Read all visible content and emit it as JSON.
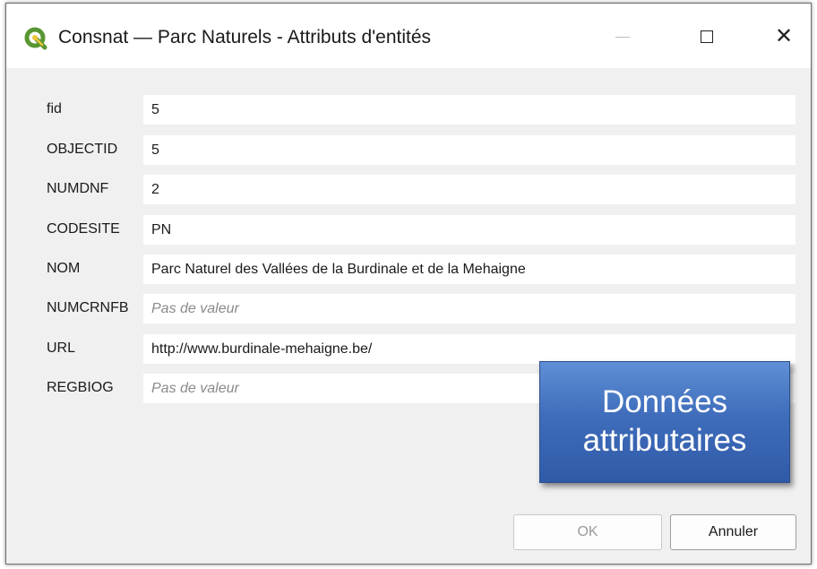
{
  "window": {
    "title": "Consnat — Parc Naturels - Attributs d'entités",
    "app_icon": "qgis-logo-icon",
    "controls": [
      "minimize-icon",
      "maximize-icon",
      "close-icon"
    ]
  },
  "fields": [
    {
      "label": "fid",
      "value": "5",
      "placeholder": ""
    },
    {
      "label": "OBJECTID",
      "value": "5",
      "placeholder": ""
    },
    {
      "label": "NUMDNF",
      "value": "2",
      "placeholder": ""
    },
    {
      "label": "CODESITE",
      "value": "PN",
      "placeholder": ""
    },
    {
      "label": "NOM",
      "value": "Parc Naturel des Vallées de la Burdinale et de la Mehaigne",
      "placeholder": ""
    },
    {
      "label": "NUMCRNFB",
      "value": "",
      "placeholder": "Pas de valeur"
    },
    {
      "label": "URL",
      "value": "http://www.burdinale-mehaigne.be/",
      "placeholder": ""
    },
    {
      "label": "REGBIOG",
      "value": "",
      "placeholder": "Pas de valeur"
    }
  ],
  "buttons": {
    "ok_label": "OK",
    "cancel_label": "Annuler"
  },
  "callout": {
    "line1": "Données",
    "line2": "attributaires"
  },
  "colors": {
    "dialog_bg": "#f0f0f0",
    "callout_blue": "#3f6dbb",
    "qgis_green": "#589632",
    "qgis_yellow": "#eec73a"
  }
}
